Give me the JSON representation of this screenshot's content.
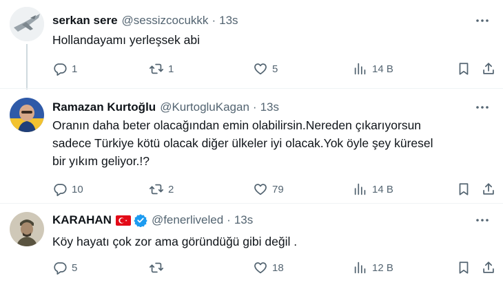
{
  "tweets": [
    {
      "name": "serkan sere",
      "handle": "@sessizcocukkk",
      "separator": "·",
      "time": "13s",
      "text": "Hollandayamı yerleşsek abi",
      "replies": "1",
      "retweets": "1",
      "likes": "5",
      "views": "14 B"
    },
    {
      "name": "Ramazan Kurtoğlu",
      "handle": "@KurtogluKagan",
      "separator": "·",
      "time": "13s",
      "text": "Oranın daha beter olacağından emin olabilirsin.Nereden çıkarıyorsun sadece Türkiye kötü olacak diğer ülkeler iyi olacak.Yok öyle şey küresel bir yıkım geliyor.!?",
      "replies": "10",
      "retweets": "2",
      "likes": "79",
      "views": "14 B"
    },
    {
      "name": "KARAHAN",
      "handle": "@fenerliveled",
      "separator": "·",
      "time": "13s",
      "text": "Köy hayatı çok zor ama göründüğü gibi değil .",
      "replies": "5",
      "retweets": "",
      "likes": "18",
      "views": "12 B"
    }
  ],
  "colors": {
    "text": "#0f1419",
    "muted": "#536471",
    "verified": "#1d9bf0",
    "flag": "#e30a17",
    "thread_line": "#cfd9de"
  },
  "icons": [
    "more-icon",
    "reply-icon",
    "retweet-icon",
    "like-icon",
    "views-icon",
    "bookmark-icon",
    "share-icon",
    "verified-badge-icon",
    "turkey-flag-icon"
  ]
}
